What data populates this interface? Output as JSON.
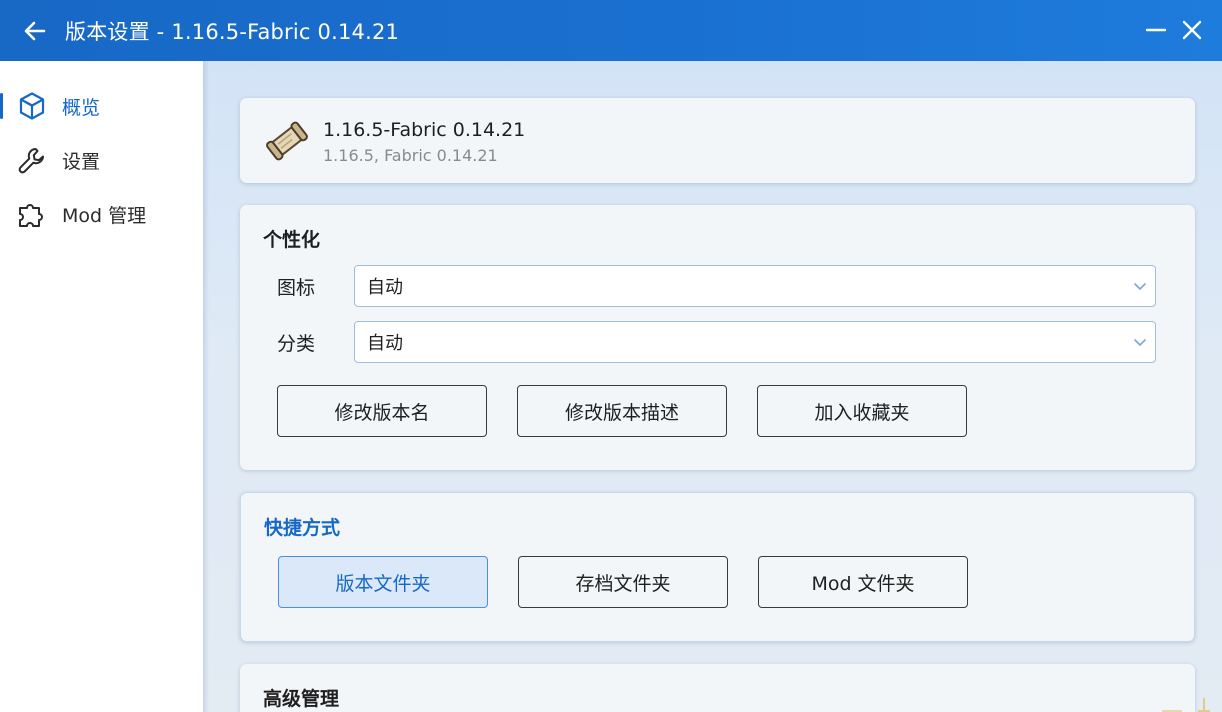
{
  "titlebar": {
    "title": "版本设置 - 1.16.5-Fabric 0.14.21",
    "back_icon": "arrow-left-icon",
    "minimize_icon": "minimize-icon",
    "close_icon": "close-icon"
  },
  "sidebar": {
    "items": [
      {
        "label": "概览",
        "icon": "cube-icon",
        "active": true
      },
      {
        "label": "设置",
        "icon": "wrench-icon",
        "active": false
      },
      {
        "label": "Mod 管理",
        "icon": "puzzle-icon",
        "active": false
      }
    ]
  },
  "header_card": {
    "icon": "scroll-icon",
    "version_name": "1.16.5-Fabric 0.14.21",
    "version_desc": "1.16.5, Fabric 0.14.21"
  },
  "personalization": {
    "title": "个性化",
    "icon_label": "图标",
    "icon_value": "自动",
    "category_label": "分类",
    "category_value": "自动",
    "buttons": [
      "修改版本名",
      "修改版本描述",
      "加入收藏夹"
    ]
  },
  "shortcuts": {
    "title": "快捷方式",
    "buttons": [
      "版本文件夹",
      "存档文件夹",
      "Mod 文件夹"
    ]
  },
  "advanced": {
    "title": "高级管理"
  },
  "colors": {
    "accent": "#1668c8",
    "titlebar": "#1a6fd0",
    "background": "#d9e6f4"
  }
}
